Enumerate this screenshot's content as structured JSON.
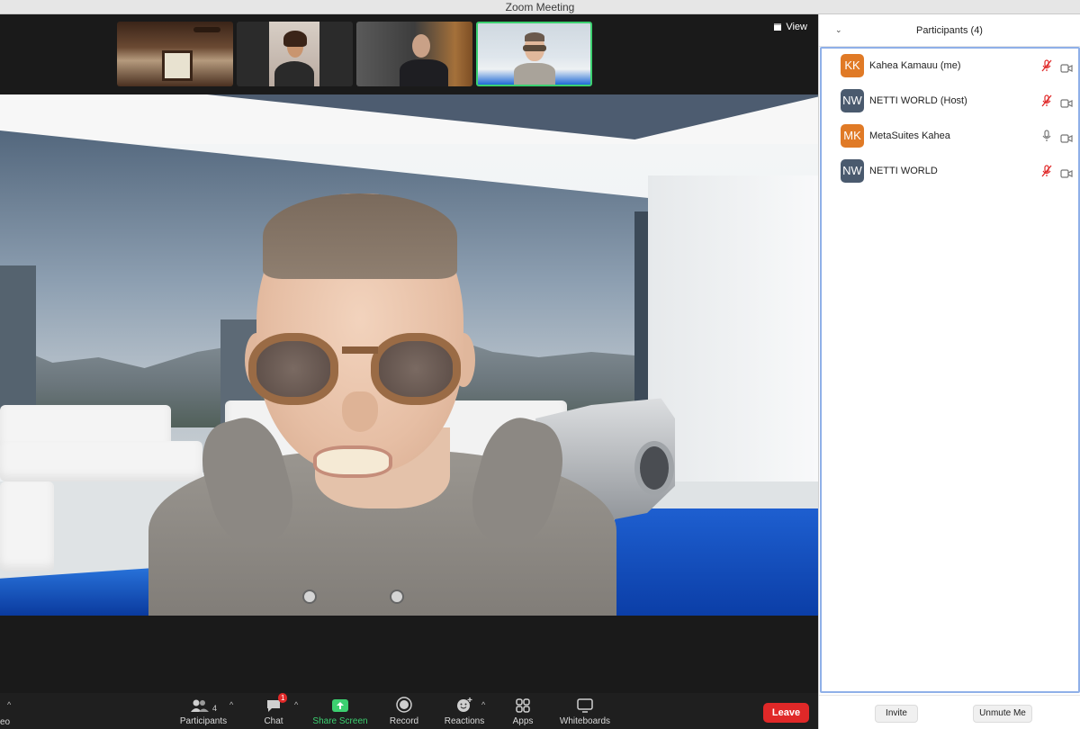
{
  "window": {
    "title": "Zoom Meeting"
  },
  "gallery": {
    "view_label": "View",
    "thumbnails": [
      {
        "name": "thumb-video-1"
      },
      {
        "name": "thumb-video-2"
      },
      {
        "name": "thumb-video-3"
      },
      {
        "name": "thumb-video-4",
        "active": true
      }
    ]
  },
  "toolbar": {
    "edge_label": "eo",
    "participants": {
      "label": "Participants",
      "count": "4"
    },
    "chat": {
      "label": "Chat",
      "badge": "1"
    },
    "share_screen": {
      "label": "Share Screen",
      "color": "#3cd070"
    },
    "record": {
      "label": "Record"
    },
    "reactions": {
      "label": "Reactions"
    },
    "apps": {
      "label": "Apps"
    },
    "whiteboards": {
      "label": "Whiteboards"
    },
    "leave": {
      "label": "Leave",
      "color": "#e02828"
    }
  },
  "participants_panel": {
    "title": "Participants (4)",
    "items": [
      {
        "initials": "KK",
        "name": "Kahea Kamauu (me)",
        "color": "#e07a26",
        "mic": "muted-mic-icon",
        "camera": "video-icon"
      },
      {
        "initials": "NW",
        "name": "NETTI WORLD (Host)",
        "color": "#4a5a6e",
        "mic": "muted-mic-icon",
        "camera": "video-icon"
      },
      {
        "initials": "MK",
        "name": "MetaSuites Kahea",
        "color": "#e07a26",
        "mic": "mic-icon",
        "camera": "video-icon"
      },
      {
        "initials": "NW",
        "name": "NETTI WORLD",
        "color": "#4a5a6e",
        "mic": "muted-mic-icon",
        "camera": "video-icon"
      }
    ],
    "invite_label": "Invite",
    "unmute_label": "Unmute Me"
  },
  "colors": {
    "active_border": "#3cd070",
    "muted_red": "#e02828",
    "panel_focus": "#8fb0e8"
  }
}
